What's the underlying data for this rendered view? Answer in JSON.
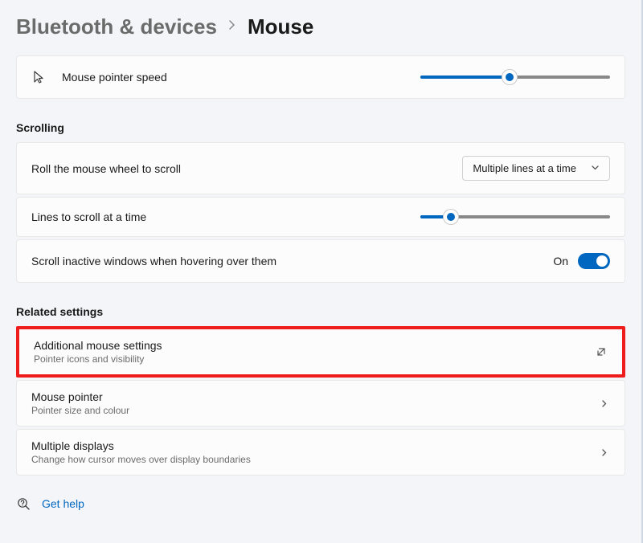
{
  "breadcrumb": {
    "parent": "Bluetooth & devices",
    "current": "Mouse"
  },
  "pointer_speed": {
    "label": "Mouse pointer speed",
    "value_percent": 47
  },
  "sections": {
    "scrolling_header": "Scrolling",
    "related_header": "Related settings"
  },
  "scroll_wheel": {
    "label": "Roll the mouse wheel to scroll",
    "selected": "Multiple lines at a time"
  },
  "lines_to_scroll": {
    "label": "Lines to scroll at a time",
    "value_percent": 16
  },
  "inactive_windows": {
    "label": "Scroll inactive windows when hovering over them",
    "state_text": "On",
    "enabled": true
  },
  "related": [
    {
      "title": "Additional mouse settings",
      "subtitle": "Pointer icons and visibility",
      "icon": "external",
      "highlighted": true
    },
    {
      "title": "Mouse pointer",
      "subtitle": "Pointer size and colour",
      "icon": "chevron",
      "highlighted": false
    },
    {
      "title": "Multiple displays",
      "subtitle": "Change how cursor moves over display boundaries",
      "icon": "chevron",
      "highlighted": false
    }
  ],
  "help": {
    "label": "Get help"
  }
}
